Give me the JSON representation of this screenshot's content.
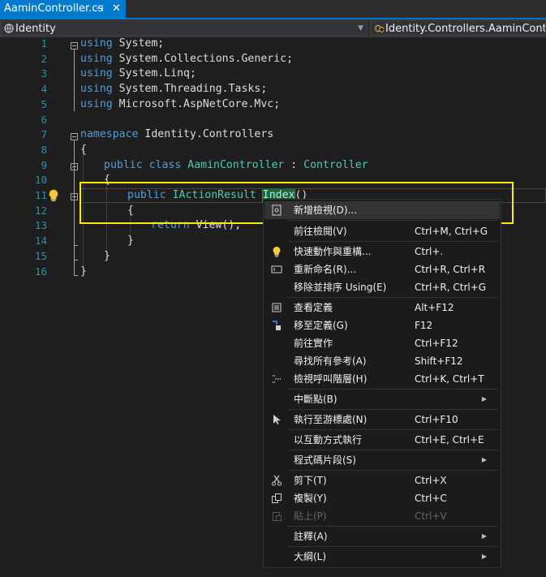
{
  "tab": {
    "title": "AaminController.cs",
    "pin": "⊣",
    "close": "✕"
  },
  "nav": {
    "left": "Identity",
    "right": "Identity.Controllers.AaminController"
  },
  "line_numbers": [
    "1",
    "2",
    "3",
    "4",
    "5",
    "6",
    "7",
    "8",
    "9",
    "10",
    "11",
    "12",
    "13",
    "14",
    "15",
    "16"
  ],
  "code": {
    "l1_kw": "using",
    "l1_rest": " System;",
    "l2_kw": "using",
    "l2_rest": " System.Collections.Generic;",
    "l3_kw": "using",
    "l3_rest": " System.Linq;",
    "l4_kw": "using",
    "l4_rest": " System.Threading.Tasks;",
    "l5_kw": "using",
    "l5_rest": " Microsoft.AspNetCore.Mvc;",
    "l7_kw": "namespace",
    "l7_rest": " Identity.Controllers",
    "l8": "{",
    "l9_kw1": "public",
    "l9_kw2": "class",
    "l9_type": "AaminController",
    "l9_colon": " : ",
    "l9_base": "Controller",
    "l10": "{",
    "l11_kw": "public",
    "l11_type": "IActionResult",
    "l11_name": "Index",
    "l11_paren": "()",
    "l12": "{",
    "l13_kw": "return",
    "l13_rest": " View();",
    "l14": "}",
    "l15": "}",
    "l16": "}"
  },
  "menu": {
    "items": [
      {
        "label": "新增檢視(D)...",
        "key": "",
        "icon": "add-view-icon"
      },
      {
        "label": "前往檢閱(V)",
        "key": "Ctrl+M, Ctrl+G",
        "icon": ""
      },
      {
        "label": "快速動作與重構...",
        "key": "Ctrl+.",
        "icon": "lightbulb-icon"
      },
      {
        "label": "重新命名(R)...",
        "key": "Ctrl+R, Ctrl+R",
        "icon": "rename-icon"
      },
      {
        "label": "移除並排序 Using(E)",
        "key": "Ctrl+R, Ctrl+G",
        "icon": ""
      },
      {
        "label": "查看定義",
        "key": "Alt+F12",
        "icon": "peek-definition-icon"
      },
      {
        "label": "移至定義(G)",
        "key": "F12",
        "icon": "go-to-definition-icon"
      },
      {
        "label": "前往實作",
        "key": "Ctrl+F12",
        "icon": ""
      },
      {
        "label": "尋找所有參考(A)",
        "key": "Shift+F12",
        "icon": ""
      },
      {
        "label": "檢視呼叫階層(H)",
        "key": "Ctrl+K, Ctrl+T",
        "icon": "call-hierarchy-icon"
      },
      {
        "label": "中斷點(B)",
        "key": "",
        "icon": ""
      },
      {
        "label": "執行至游標處(N)",
        "key": "Ctrl+F10",
        "icon": "run-to-cursor-icon"
      },
      {
        "label": "以互動方式執行",
        "key": "Ctrl+E, Ctrl+E",
        "icon": ""
      },
      {
        "label": "程式碼片段(S)",
        "key": "",
        "icon": ""
      },
      {
        "label": "剪下(T)",
        "key": "Ctrl+X",
        "icon": "cut-icon"
      },
      {
        "label": "複製(Y)",
        "key": "Ctrl+C",
        "icon": "copy-icon"
      },
      {
        "label": "貼上(P)",
        "key": "Ctrl+V",
        "icon": "paste-icon"
      },
      {
        "label": "註釋(A)",
        "key": "",
        "icon": ""
      },
      {
        "label": "大綱(L)",
        "key": "",
        "icon": ""
      }
    ],
    "submenu_arrow": "▶"
  },
  "colors": {
    "accent": "#007acc",
    "highlight": "#ffeb00",
    "keyword": "#569cd6",
    "type": "#4ec9b0",
    "line_number": "#2b91af"
  }
}
